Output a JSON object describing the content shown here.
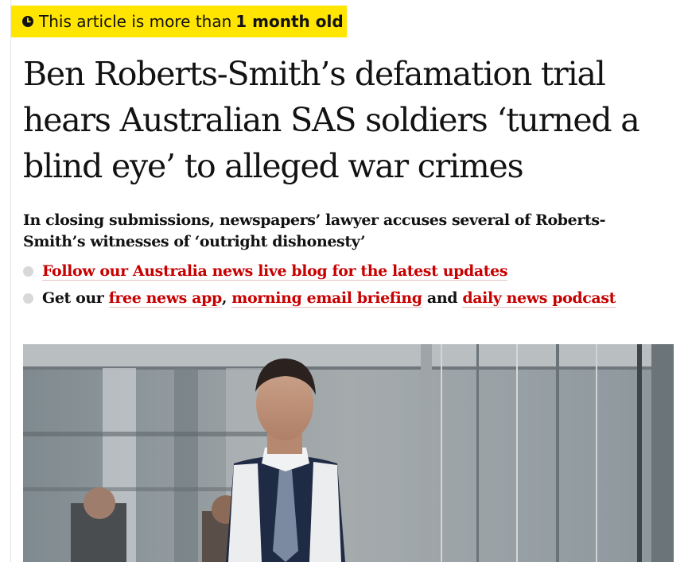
{
  "banner": {
    "prefix": "This article is more than",
    "age": "1 month old",
    "icon": "clock-icon",
    "color": "#ffe500"
  },
  "headline": "Ben Roberts-Smith’s defamation trial hears Australian SAS soldiers ‘turned a blind eye’ to alleged war crimes",
  "standfirst": "In closing submissions, newspapers’ lawyer accuses several of Roberts-Smith’s witnesses of ‘outright dishonesty’",
  "links": {
    "live_blog": "Follow our Australia news live blog for the latest updates",
    "get_our": "Get our",
    "news_app": "free news app",
    "comma": ",",
    "email": "morning email briefing",
    "and": "and",
    "podcast": "daily news podcast"
  },
  "colors": {
    "link": "#c70000",
    "text": "#121212",
    "bullet": "#d8d8d8"
  }
}
